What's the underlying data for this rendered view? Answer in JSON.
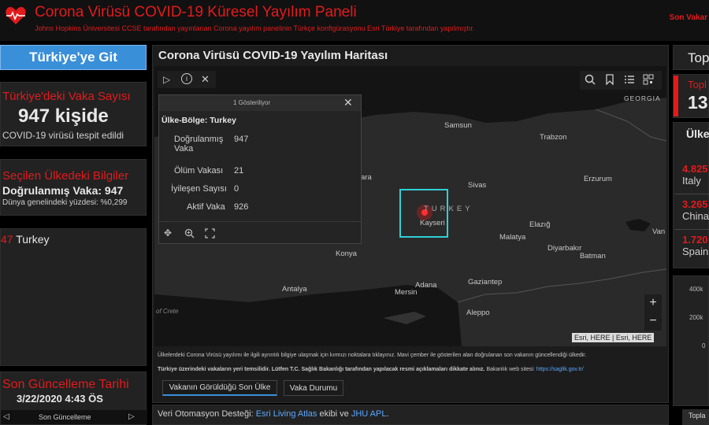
{
  "header": {
    "title": "Corona Virüsü COVID-19 Küresel Yayılım Paneli",
    "subtitle": "Johns Hopkins Üniversitesi CCSE tarafından yayınlanan Corona yayılım panelinin Türkçe konfigürasyonu Esri Türkiye tarafından yapılmıştır.",
    "right_text": "Son Vakar"
  },
  "left": {
    "goto_button": "Türkiye'ye Git",
    "turkey_cases_title": "Türkiye'deki Vaka Sayısı",
    "turkey_cases_value": "947 kişide",
    "turkey_cases_sub": "COVID-19 virüsü tespit edildi",
    "selected_title": "Seçilen Ülkedeki Bilgiler",
    "selected_confirmed": "Doğrulanmış Vaka: 947",
    "selected_share": "Dünya genelindeki yüzdesi: %0,299",
    "list_count": "47",
    "list_name": "Turkey",
    "updated_title": "Son Güncelleme Tarihi",
    "updated_value": "3/22/2020 4:43 ÖS",
    "updated_nav_label": "Son Güncelleme"
  },
  "map": {
    "title": "Corona Virüsü COVID-19 Yayılım Haritası",
    "attribution": "Esri, HERE | Esri, HERE",
    "zoom_in": "+",
    "zoom_out": "−",
    "country_label": "TURKEY",
    "region_label": "GEORGIA",
    "cities": [
      {
        "name": "Samsun"
      },
      {
        "name": "Trabzon"
      },
      {
        "name": "Sivas"
      },
      {
        "name": "Erzurum"
      },
      {
        "name": "Kayseri"
      },
      {
        "name": "Elazığ"
      },
      {
        "name": "Malatya"
      },
      {
        "name": "Diyarbakır"
      },
      {
        "name": "Batman"
      },
      {
        "name": "Konya"
      },
      {
        "name": "Antalya"
      },
      {
        "name": "Adana"
      },
      {
        "name": "Mersin"
      },
      {
        "name": "Gaziantep"
      },
      {
        "name": "Aleppo"
      },
      {
        "name": "Van"
      },
      {
        "name": "ara"
      },
      {
        "name": "of Crete"
      }
    ],
    "footer_line1": "Ülkelerdeki Corona Virüsü yayılımı ile ilgili ayrıntılı bilgiye ulaşmak için kırmızı noktalara tıklayınız. Mavi çember ile gösterilen alan doğrulanan son vakanın güncellendiği ülkedir.",
    "footer_line2_bold": "Türkiye üzerindeki vakaların yeri temsilidir. Lütfen T.C. Sağlık Bakanlığı tarafından yapılacak resmi açıklamaları dikkate alınız.",
    "footer_line2_tail": " Bakanlık web sitesi: ",
    "footer_link": "https://saglik.gov.tr/",
    "tabs": [
      "Vakanın Görüldüğü Son Ülke",
      "Vaka Durumu"
    ]
  },
  "popup": {
    "header": "1 Gösteriliyor",
    "country_line": "Ülke-Bölge: Turkey",
    "rows": [
      {
        "label": "Doğrulanmış",
        "label2": "Vaka",
        "value": "947"
      },
      {
        "label": "Ölüm Vakası",
        "value": "21"
      },
      {
        "label": "İyileşen Sayısı",
        "value": "0"
      },
      {
        "label": "Aktif Vaka",
        "value": "926"
      }
    ]
  },
  "bottom_bar": {
    "prefix": "Veri Otomasyon Desteği: ",
    "link1": "Esri Living Atlas",
    "middle": " ekibi ve ",
    "link2": "JHU APL",
    "suffix": "."
  },
  "right": {
    "top_text": "Top",
    "total_label": "Topl",
    "total_value": "13",
    "list_header": "Ülke",
    "items": [
      {
        "value": "4.825",
        "name": "Italy"
      },
      {
        "value": "3.265",
        "name": "China"
      },
      {
        "value": "1.720",
        "name": "Spain"
      }
    ],
    "axis_ticks": [
      "400k",
      "200k",
      "0"
    ],
    "bottom_label": "Topla"
  },
  "colors": {
    "accent_red": "#e31a1c",
    "button_blue": "#3a8fd9",
    "highlight_cyan": "#2fd0d8",
    "link_blue": "#5aa9ff"
  }
}
